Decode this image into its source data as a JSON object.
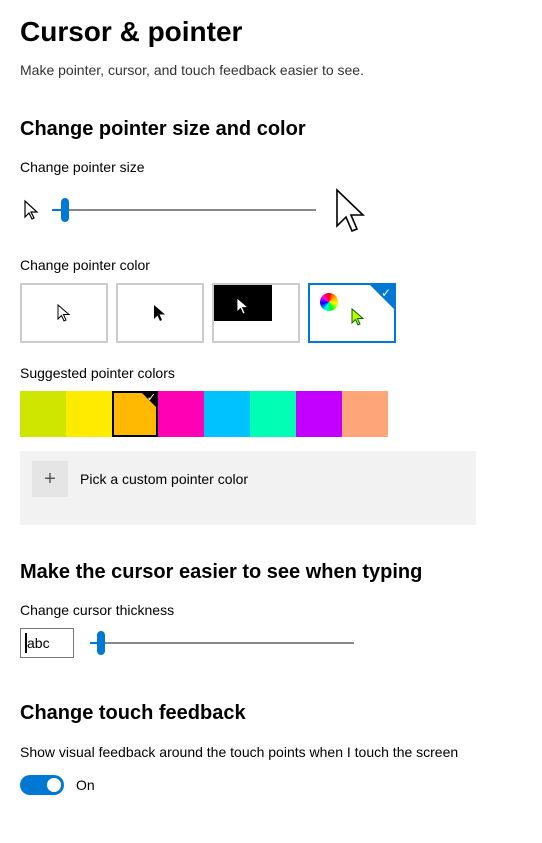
{
  "page": {
    "title": "Cursor & pointer",
    "subtitle": "Make pointer, cursor, and touch feedback easier to see."
  },
  "pointer_size": {
    "heading": "Change pointer size and color",
    "label": "Change pointer size",
    "value_percent": 5
  },
  "pointer_color": {
    "label": "Change pointer color",
    "schemes": [
      {
        "id": "white",
        "selected": false
      },
      {
        "id": "black",
        "selected": false
      },
      {
        "id": "inverted",
        "selected": false
      },
      {
        "id": "custom",
        "selected": true
      }
    ]
  },
  "suggested_colors": {
    "label": "Suggested pointer colors",
    "colors": [
      {
        "hex": "#cfe600",
        "selected": false
      },
      {
        "hex": "#ffeb00",
        "selected": false
      },
      {
        "hex": "#ffb900",
        "selected": true
      },
      {
        "hex": "#ff00b4",
        "selected": false
      },
      {
        "hex": "#00c2ff",
        "selected": false
      },
      {
        "hex": "#00ffb4",
        "selected": false
      },
      {
        "hex": "#c300ff",
        "selected": false
      },
      {
        "hex": "#ffa57a",
        "selected": false
      }
    ]
  },
  "custom_color": {
    "button_label": "Pick a custom pointer color"
  },
  "cursor_thickness": {
    "heading": "Make the cursor easier to see when typing",
    "label": "Change cursor thickness",
    "preview_text": "abc",
    "value_percent": 4
  },
  "touch_feedback": {
    "heading": "Change touch feedback",
    "label": "Show visual feedback around the touch points when I touch the screen",
    "toggle_on": true,
    "toggle_text": "On"
  }
}
